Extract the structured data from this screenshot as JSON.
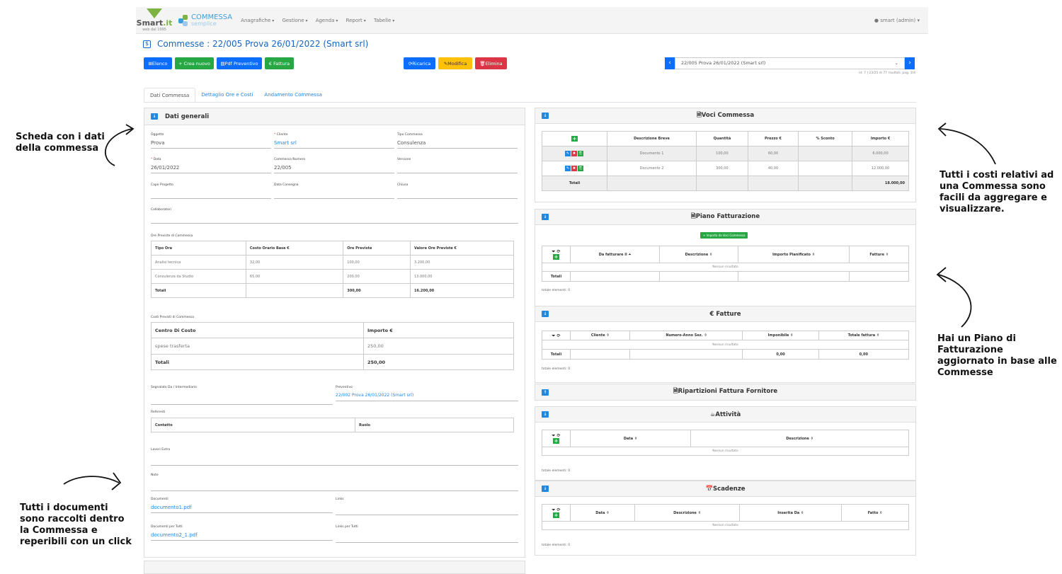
{
  "annotations": {
    "left_top": "Scheda con i dati\ndella commessa",
    "left_bottom": "Tutti i documenti\nsono raccolti dentro\nla Commessa e\nreperibili con un click",
    "right_top": "Tutti i costi relativi ad\nuna Commessa sono\nfacili da aggregare e\nvisualizzare.",
    "right_bottom": "Hai un Piano di\nFatturazione\naggiornato in base alle\nCommesse"
  },
  "nav": {
    "logo_smart": "Smart",
    "logo_it": ".it",
    "logo_sub": "web dal 1995",
    "logo_commessa": "COMMESSA",
    "logo_semplice": "semplice",
    "menu": [
      "Anagrafiche",
      "Gestione",
      "Agenda",
      "Report",
      "Tabelle"
    ],
    "user": "smart (admin)"
  },
  "page_title": "Commesse : 22/005 Prova 26/01/2022 (Smart srl)",
  "toolbar": {
    "elenco": "Elenco",
    "crea": "+ Crea nuovo",
    "pdf": "Pdf Preventivo",
    "fattura": "€ Fattura",
    "ricarica": "Ricarica",
    "modifica": "Modifica",
    "elimina": "Elimina"
  },
  "pager": {
    "selected": "22/005 Prova 26/01/2022 (Smart srl)",
    "info": "id: 7 | 23/25 di 77 risultati. pag. 3/4"
  },
  "tabs": [
    "Dati Commessa",
    "Dettaglio Ore e Costi",
    "Andamento Commessa"
  ],
  "dati": {
    "header": "Dati generali",
    "oggetto_l": "Oggetto",
    "oggetto": "Prova",
    "cliente_l": "Cliente",
    "cliente": "Smart srl",
    "tipo_l": "Tipo Commessa",
    "tipo": "Consulenza",
    "data_l": "Data",
    "data": "26/01/2022",
    "numero_l": "Commessa Numero",
    "numero": "22/005",
    "versione_l": "Versione",
    "capo_l": "Capo Progetto",
    "consegna_l": "Data Consegna",
    "chiusa_l": "Chiusa",
    "collab_l": "Collaboratori",
    "ore_title": "Ore Previste di Commessa",
    "ore_head": [
      "Tipo Ora",
      "Costo Orario Base €",
      "Ore Previste",
      "Valore Ore Previste €"
    ],
    "ore_rows": [
      [
        "Analisi tecnica",
        "32,00",
        "100,00",
        "3.200,00"
      ],
      [
        "Consulenza da Studio",
        "65,00",
        "200,00",
        "13.000,00"
      ]
    ],
    "ore_tot": [
      "Totali",
      "",
      "300,00",
      "16.200,00"
    ],
    "costi_title": "Costi Previsti di Commessa",
    "costi_head": [
      "Centro Di Costo",
      "Importo €"
    ],
    "costi_rows": [
      [
        "spese trasferta",
        "250,00"
      ]
    ],
    "costi_tot": [
      "Totali",
      "250,00"
    ],
    "segnalato_l": "Segnalato Da / Intermediario",
    "preventivo_l": "Preventivo",
    "preventivo": "22/002 Prova 26/01/2022 (Smart srl)",
    "referenti_l": "Referenti",
    "ref_head": [
      "Contatto",
      "Ruolo"
    ],
    "lavori_l": "Lavori Extra",
    "note_l": "Note",
    "documenti_l": "Documenti",
    "documento": "documento1.pdf",
    "links_l": "Links",
    "doc_tutti_l": "Documenti per Tutti",
    "doc_tutti": "documento2_1.pdf",
    "links_tutti_l": "Links per Tutti"
  },
  "voci": {
    "header": "Voci Commessa",
    "head": [
      "Descrizione Breve",
      "Quantità",
      "Prezzo €",
      "% Sconto",
      "Importo €"
    ],
    "rows": [
      [
        "Documento 1",
        "100,00",
        "60,00",
        "",
        "6.000,00"
      ],
      [
        "Documento 2",
        "300,00",
        "40,00",
        "",
        "12.000,00"
      ]
    ],
    "tot_l": "Totali",
    "tot": "18.000,00"
  },
  "piano": {
    "header": "Piano Fatturazione",
    "btn": "+ Importa da Voci Commessa",
    "head": [
      "Da fatturare il ⏶",
      "Descrizione ⇳",
      "Importo Pianificato ⇳",
      "Fatture ⇳"
    ],
    "empty": "Nessun risultato",
    "tot_l": "Totali",
    "count": "totale elementi: 0"
  },
  "fatture": {
    "header": "€ Fatture",
    "head": [
      "Cliente ⇳",
      "Numero-Anno Sez. ⇳",
      "Imponibile ⇳",
      "Totale fattura ⇳"
    ],
    "empty": "Nessun risultato",
    "tot_l": "Totali",
    "tot1": "0,00",
    "tot2": "0,00",
    "count": "totale elementi: 0"
  },
  "ripartizioni": {
    "header": "Ripartizioni Fattura Fornitore"
  },
  "attivita": {
    "header": "Attività",
    "head": [
      "Data ⇳",
      "Descrizione ⇳"
    ],
    "empty": "Nessun risultato",
    "count": "totale elementi: 0"
  },
  "scadenze": {
    "header": "Scadenze",
    "head": [
      "Data ⇳",
      "Descrizione ⇳",
      "Inserita Da ⇳",
      "Fatto ⇳"
    ],
    "empty": "Nessun risultato",
    "count": "totale elementi: 0"
  }
}
